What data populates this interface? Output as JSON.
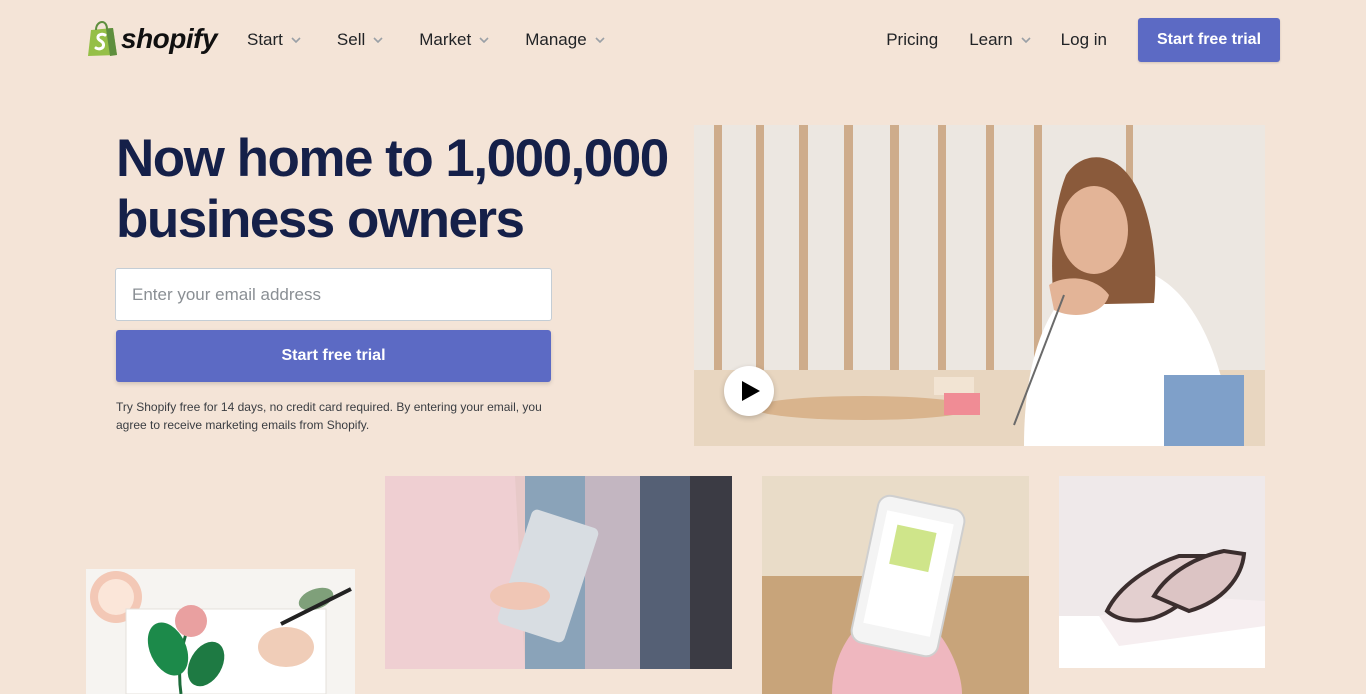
{
  "brand": {
    "name": "shopify",
    "logo_icon": "shopping-bag-icon",
    "color": "#95bf47"
  },
  "nav": {
    "left": [
      {
        "label": "Start",
        "has_dropdown": true
      },
      {
        "label": "Sell",
        "has_dropdown": true
      },
      {
        "label": "Market",
        "has_dropdown": true
      },
      {
        "label": "Manage",
        "has_dropdown": true
      }
    ],
    "right": {
      "pricing": "Pricing",
      "learn": "Learn",
      "login": "Log in",
      "cta": "Start free trial"
    }
  },
  "hero": {
    "title": "Now home to 1,000,000 business owners",
    "email_placeholder": "Enter your email address",
    "cta": "Start free trial",
    "disclaimer": "Try Shopify free for 14 days, no credit card required. By entering your email, you agree to receive marketing emails from Shopify.",
    "video_icon": "play-icon"
  },
  "colors": {
    "background": "#f4e4d7",
    "accent": "#5c6ac4",
    "heading": "#152049"
  }
}
